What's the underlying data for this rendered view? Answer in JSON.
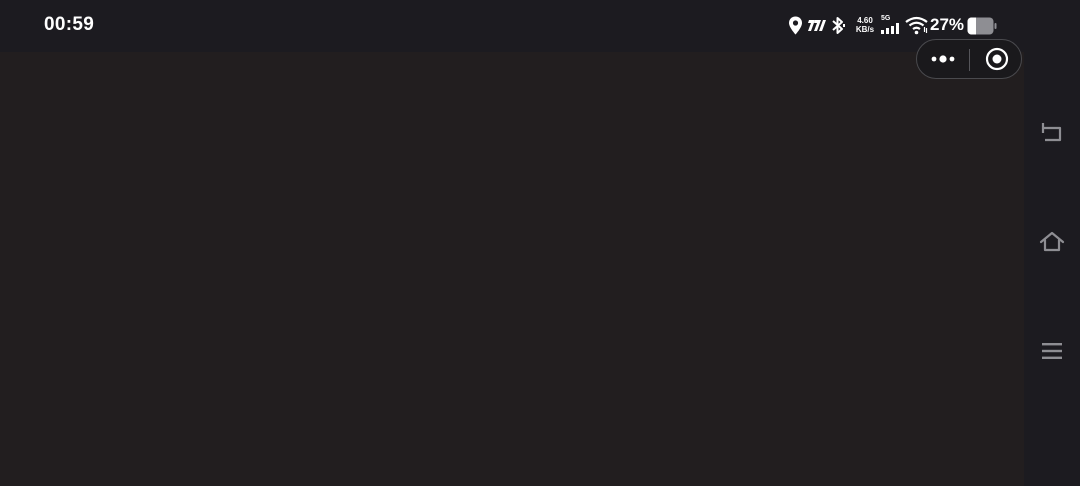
{
  "status_bar": {
    "time": "00:59",
    "net_speed_value": "4.60",
    "net_speed_unit": "KB/s",
    "signal_label": "5G",
    "battery_percent": "27%",
    "icons": [
      "location-icon",
      "carrier-icon",
      "bluetooth-icon",
      "signal-icon",
      "wifi-icon",
      "battery-icon"
    ]
  },
  "capsule": {
    "icons": [
      "more-icon",
      "close-target-icon"
    ]
  },
  "navigation_bar": {
    "icons": [
      "back-icon",
      "home-icon",
      "menu-icon"
    ]
  },
  "colors": {
    "background": "#221e1f",
    "status_bar": "#1c1b20",
    "nav_bar": "#1c1b20",
    "icon_gray": "#8e8e93",
    "text": "#ffffff"
  }
}
